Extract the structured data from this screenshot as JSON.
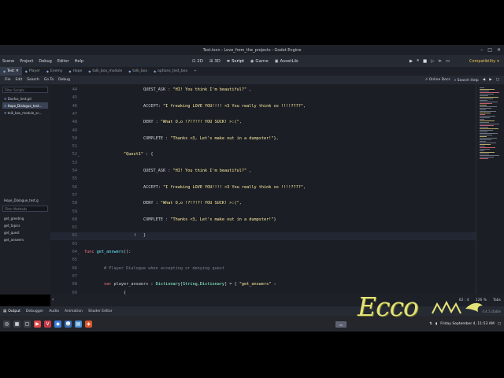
{
  "window": {
    "title": "Test.tscn - Love_from_the_projects - Godot Engine"
  },
  "menu": [
    "Scene",
    "Project",
    "Debug",
    "Editor",
    "Help"
  ],
  "workspaces": [
    {
      "icon": "view-2d-icon",
      "glyph": "⊡",
      "label": "2D"
    },
    {
      "icon": "view-3d-icon",
      "glyph": "⊞",
      "label": "3D"
    },
    {
      "icon": "script-icon",
      "glyph": "≣",
      "label": "Script"
    },
    {
      "icon": "game-icon",
      "glyph": "◉",
      "label": "Game"
    },
    {
      "icon": "assetlib-icon",
      "glyph": "▣",
      "label": "AssetLib"
    }
  ],
  "renderer": "Compatibility",
  "scene_tabs": [
    "Test",
    "Player",
    "Enemy",
    "Hope",
    "talk_box_module",
    "talk_box",
    "options_test_box"
  ],
  "script_menu": [
    "File",
    "Edit",
    "Search",
    "Go To",
    "Debug"
  ],
  "right_buttons": {
    "online_docs": "Online Docs",
    "search_help": "Search Help"
  },
  "left_panel": {
    "filter_scripts": "Filter Scripts",
    "scripts": [
      "Doofus_test.gd",
      "Hope_Dialogue_test...",
      "talk_box_module_sc..."
    ],
    "current_script": "Hope_Dialogue_test.g",
    "filter_methods": "Filter Methods",
    "methods": [
      "get_greeting",
      "get_topics",
      "get_quest",
      "get_answers"
    ]
  },
  "code": [
    {
      "n": "44",
      "seg": [
        [
          "dot",
          "\t\t\t"
        ],
        [
          "",
          "QUEST_ASK : "
        ],
        [
          "str",
          "\"HI! You think I'm beautiful?\""
        ],
        [
          "",
          " ,"
        ]
      ]
    },
    {
      "n": "45",
      "seg": [
        [
          "dot",
          "\t\t\t"
        ]
      ]
    },
    {
      "n": "46",
      "seg": [
        [
          "dot",
          "\t\t\t"
        ],
        [
          "",
          "ACCEPT: "
        ],
        [
          "str",
          "\"I freaking LOVE YOU!!!! <3 You really think so !!!!????\""
        ],
        [
          "",
          ","
        ]
      ]
    },
    {
      "n": "47",
      "seg": [
        [
          "dot",
          "\t\t\t"
        ]
      ]
    },
    {
      "n": "48",
      "seg": [
        [
          "dot",
          "\t\t\t"
        ],
        [
          "",
          "DENY : "
        ],
        [
          "str",
          "\"What O,o !?!?!?! YOU SUCK! >:(\""
        ],
        [
          "",
          ","
        ]
      ]
    },
    {
      "n": "49",
      "seg": [
        [
          "dot",
          "\t\t\t"
        ]
      ]
    },
    {
      "n": "50",
      "seg": [
        [
          "dot",
          "\t\t\t"
        ],
        [
          "",
          "COMPLETE : "
        ],
        [
          "str",
          "\"Thanks <3, Let's make out in a dumpster!\""
        ],
        [
          "",
          "},"
        ]
      ]
    },
    {
      "n": "51",
      "seg": [
        [
          "dot",
          "\t\t"
        ]
      ]
    },
    {
      "n": "52",
      "seg": [
        [
          "dot",
          "\t\t"
        ],
        [
          "str",
          "\"Quest1\""
        ],
        [
          "",
          " : {"
        ]
      ]
    },
    {
      "n": "53",
      "seg": [
        [
          "dot",
          "\t\t\t"
        ]
      ]
    },
    {
      "n": "54",
      "seg": [
        [
          "dot",
          "\t\t\t"
        ],
        [
          "",
          "QUEST_ASK : "
        ],
        [
          "str",
          "\"HI! You think I'm beautiful?\""
        ],
        [
          "",
          " ,"
        ]
      ]
    },
    {
      "n": "55",
      "seg": [
        [
          "dot",
          "\t\t\t"
        ]
      ]
    },
    {
      "n": "56",
      "seg": [
        [
          "dot",
          "\t\t\t"
        ],
        [
          "",
          "ACCEPT: "
        ],
        [
          "str",
          "\"I freaking LOVE YOU!!!! <3 You really think so !!!!????\""
        ],
        [
          "",
          ","
        ]
      ]
    },
    {
      "n": "57",
      "seg": [
        [
          "dot",
          "\t\t\t"
        ]
      ]
    },
    {
      "n": "58",
      "seg": [
        [
          "dot",
          "\t\t\t"
        ],
        [
          "",
          "DENY : "
        ],
        [
          "str",
          "\"What O,o !?!?!?! YOU SUCK! >:(\""
        ],
        [
          "",
          ","
        ]
      ]
    },
    {
      "n": "59",
      "seg": [
        [
          "dot",
          "\t\t\t"
        ]
      ]
    },
    {
      "n": "60",
      "seg": [
        [
          "dot",
          "\t\t\t"
        ],
        [
          "",
          "COMPLETE : "
        ],
        [
          "str",
          "\"Thanks <3, Let's make out in a dumpster!\""
        ],
        [
          "",
          "}"
        ]
      ]
    },
    {
      "n": "61",
      "seg": [
        [
          "dot",
          "\t\t\t"
        ]
      ]
    },
    {
      "n": "62",
      "seg": [
        [
          "dot",
          "\t\t\t"
        ],
        [
          "",
          "}"
        ]
      ]
    },
    {
      "n": "63",
      "seg": []
    },
    {
      "n": "64",
      "seg": [
        [
          "kw",
          "func "
        ],
        [
          "fn",
          "get_answers"
        ],
        [
          "",
          "():"
        ]
      ]
    },
    {
      "n": "65",
      "seg": [
        [
          "dot",
          "\t"
        ]
      ]
    },
    {
      "n": "66",
      "seg": [
        [
          "dot",
          "\t"
        ],
        [
          "cm",
          "# Player Dialogue when accepting or denying quest"
        ]
      ]
    },
    {
      "n": "67",
      "seg": [
        [
          "dot",
          "\t"
        ]
      ]
    },
    {
      "n": "68",
      "seg": [
        [
          "dot",
          "\t"
        ],
        [
          "kw",
          "var "
        ],
        [
          "",
          "player_answers : "
        ],
        [
          "ty",
          "Dictionary"
        ],
        [
          "",
          "["
        ],
        [
          "ty",
          "String"
        ],
        [
          "",
          ","
        ],
        [
          "ty",
          "Dictionary"
        ],
        [
          "",
          "] = { "
        ],
        [
          "str",
          "\"get_answers\""
        ],
        [
          "",
          " :"
        ]
      ]
    },
    {
      "n": "69",
      "seg": [
        [
          "dot",
          "\t\t"
        ],
        [
          "",
          "{"
        ]
      ]
    }
  ],
  "status": {
    "position": "62 : 4",
    "zoom": "126 %",
    "indent": "Tabs"
  },
  "bottom_tabs": [
    "Output",
    "Debugger",
    "Audio",
    "Animation",
    "Shader Editor"
  ],
  "active_bottom_tab": "Output",
  "version": "4.4.1.stable",
  "watermark": "Ecco",
  "clock": "Friday September 4, 11:53 AM"
}
